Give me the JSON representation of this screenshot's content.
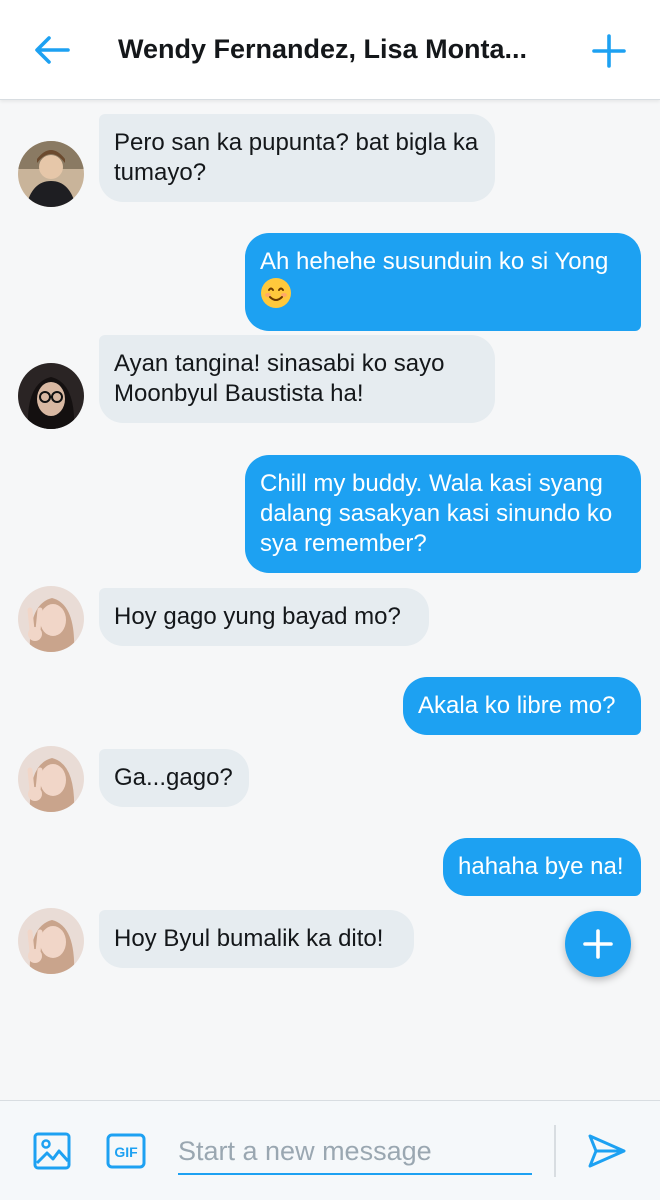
{
  "header": {
    "title": "Wendy Fernandez, Lisa Monta..."
  },
  "messages": [
    {
      "direction": "in",
      "text": "Pero san ka pupunta? bat bigla ka tumayo?",
      "avatar": "avatar-black-jacket"
    },
    {
      "direction": "out",
      "text": "Ah hehehe susunduin ko si Yong",
      "emoji": "smiling-face-emoji"
    },
    {
      "direction": "in",
      "text": "Ayan tangina! sinasabi ko sayo Moonbyul Baustista ha!",
      "avatar": "avatar-glasses"
    },
    {
      "direction": "out",
      "text": "Chill my buddy. Wala kasi syang dalang sasakyan kasi sinundo ko sya remember?"
    },
    {
      "direction": "in",
      "text": "Hoy gago yung bayad mo?",
      "avatar": "avatar-peace-sign"
    },
    {
      "direction": "out",
      "text": "Akala ko libre mo?"
    },
    {
      "direction": "in",
      "text": "Ga...gago?",
      "avatar": "avatar-peace-sign"
    },
    {
      "direction": "out",
      "text": "hahaha bye na!"
    },
    {
      "direction": "in",
      "text": "Hoy Byul bumalik ka dito!",
      "avatar": "avatar-peace-sign"
    }
  ],
  "composer": {
    "placeholder": "Start a new message",
    "value": "",
    "gif_label": "GIF"
  },
  "colors": {
    "accent": "#1da1f2",
    "incoming_bubble": "#e6ecf0",
    "background": "#f6f7f8"
  },
  "icons": {
    "back": "arrow-left-icon",
    "add_people": "plus-icon",
    "fab": "plus-icon",
    "media": "image-icon",
    "gif": "gif-icon",
    "send": "send-icon"
  }
}
